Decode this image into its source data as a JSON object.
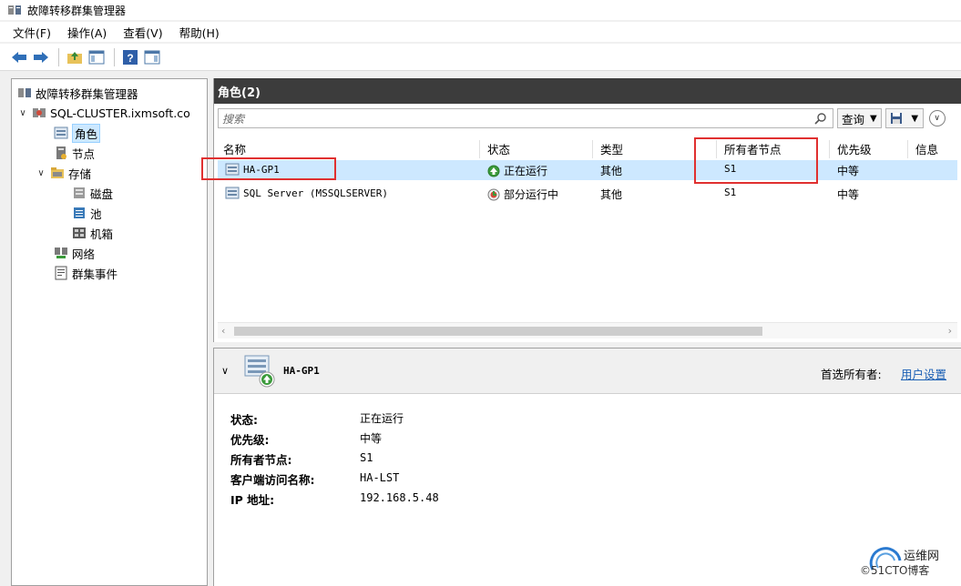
{
  "window": {
    "title": "故障转移群集管理器"
  },
  "menu": [
    "文件(F)",
    "操作(A)",
    "查看(V)",
    "帮助(H)"
  ],
  "tree": {
    "root": "故障转移群集管理器",
    "cluster": "SQL-CLUSTER.ixmsoft.co",
    "items": {
      "roles": "角色",
      "nodes": "节点",
      "storage": "存储",
      "disks": "磁盘",
      "pools": "池",
      "enclosures": "机箱",
      "networks": "网络",
      "events": "群集事件"
    }
  },
  "roles_pane": {
    "header": "角色(2)",
    "search_placeholder": "搜索",
    "query_label": "查询",
    "columns": [
      "名称",
      "状态",
      "类型",
      "所有者节点",
      "优先级",
      "信息"
    ],
    "rows": [
      {
        "name": "HA-GP1",
        "status": "正在运行",
        "type": "其他",
        "owner": "S1",
        "priority": "中等"
      },
      {
        "name": "SQL Server (MSSQLSERVER)",
        "status": "部分运行中",
        "type": "其他",
        "owner": "S1",
        "priority": "中等"
      }
    ]
  },
  "details": {
    "title": "HA-GP1",
    "preferred_owner_label": "首选所有者:",
    "preferred_owner_link": "用户设置",
    "props": [
      {
        "label": "状态:",
        "value": "正在运行"
      },
      {
        "label": "优先级:",
        "value": "中等"
      },
      {
        "label": "所有者节点:",
        "value": "S1"
      },
      {
        "label": "客户端访问名称:",
        "value": "HA-LST"
      },
      {
        "label": "IP 地址:",
        "value": "192.168.5.48"
      }
    ]
  },
  "watermark": {
    "line1": "运维网",
    "line2": "©51CTO博客"
  },
  "colors": {
    "selection": "#cde8ff",
    "header_dark": "#3c3c3c",
    "highlight_box": "#e03030",
    "link": "#1a5fb4"
  }
}
